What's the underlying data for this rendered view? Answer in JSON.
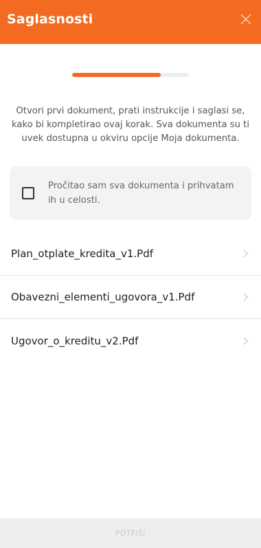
{
  "header": {
    "title": "Saglasnosti",
    "close_icon": "close-icon"
  },
  "progress": {
    "fraction": 0.76
  },
  "instructions": "Otvori prvi dokument, prati instrukcije i saglasi se, kako bi kompletirao ovaj korak. Sva dokumenta su ti uvek dostupna u okviru opcije Moja dokumenta.",
  "consent": {
    "label": "Pročitao sam sva dokumenta i prihvatam ih u celosti.",
    "checked": false
  },
  "documents": [
    {
      "name": "Plan_otplate_kredita_v1.Pdf"
    },
    {
      "name": "Obavezni_elementi_ugovora_v1.Pdf"
    },
    {
      "name": "Ugovor_o_kreditu_v2.Pdf"
    }
  ],
  "footer": {
    "sign_label": "POTPIŠI"
  },
  "colors": {
    "accent": "#f26b21",
    "footer_bg": "#eeeeee",
    "disabled_text": "#c8c8c8"
  }
}
